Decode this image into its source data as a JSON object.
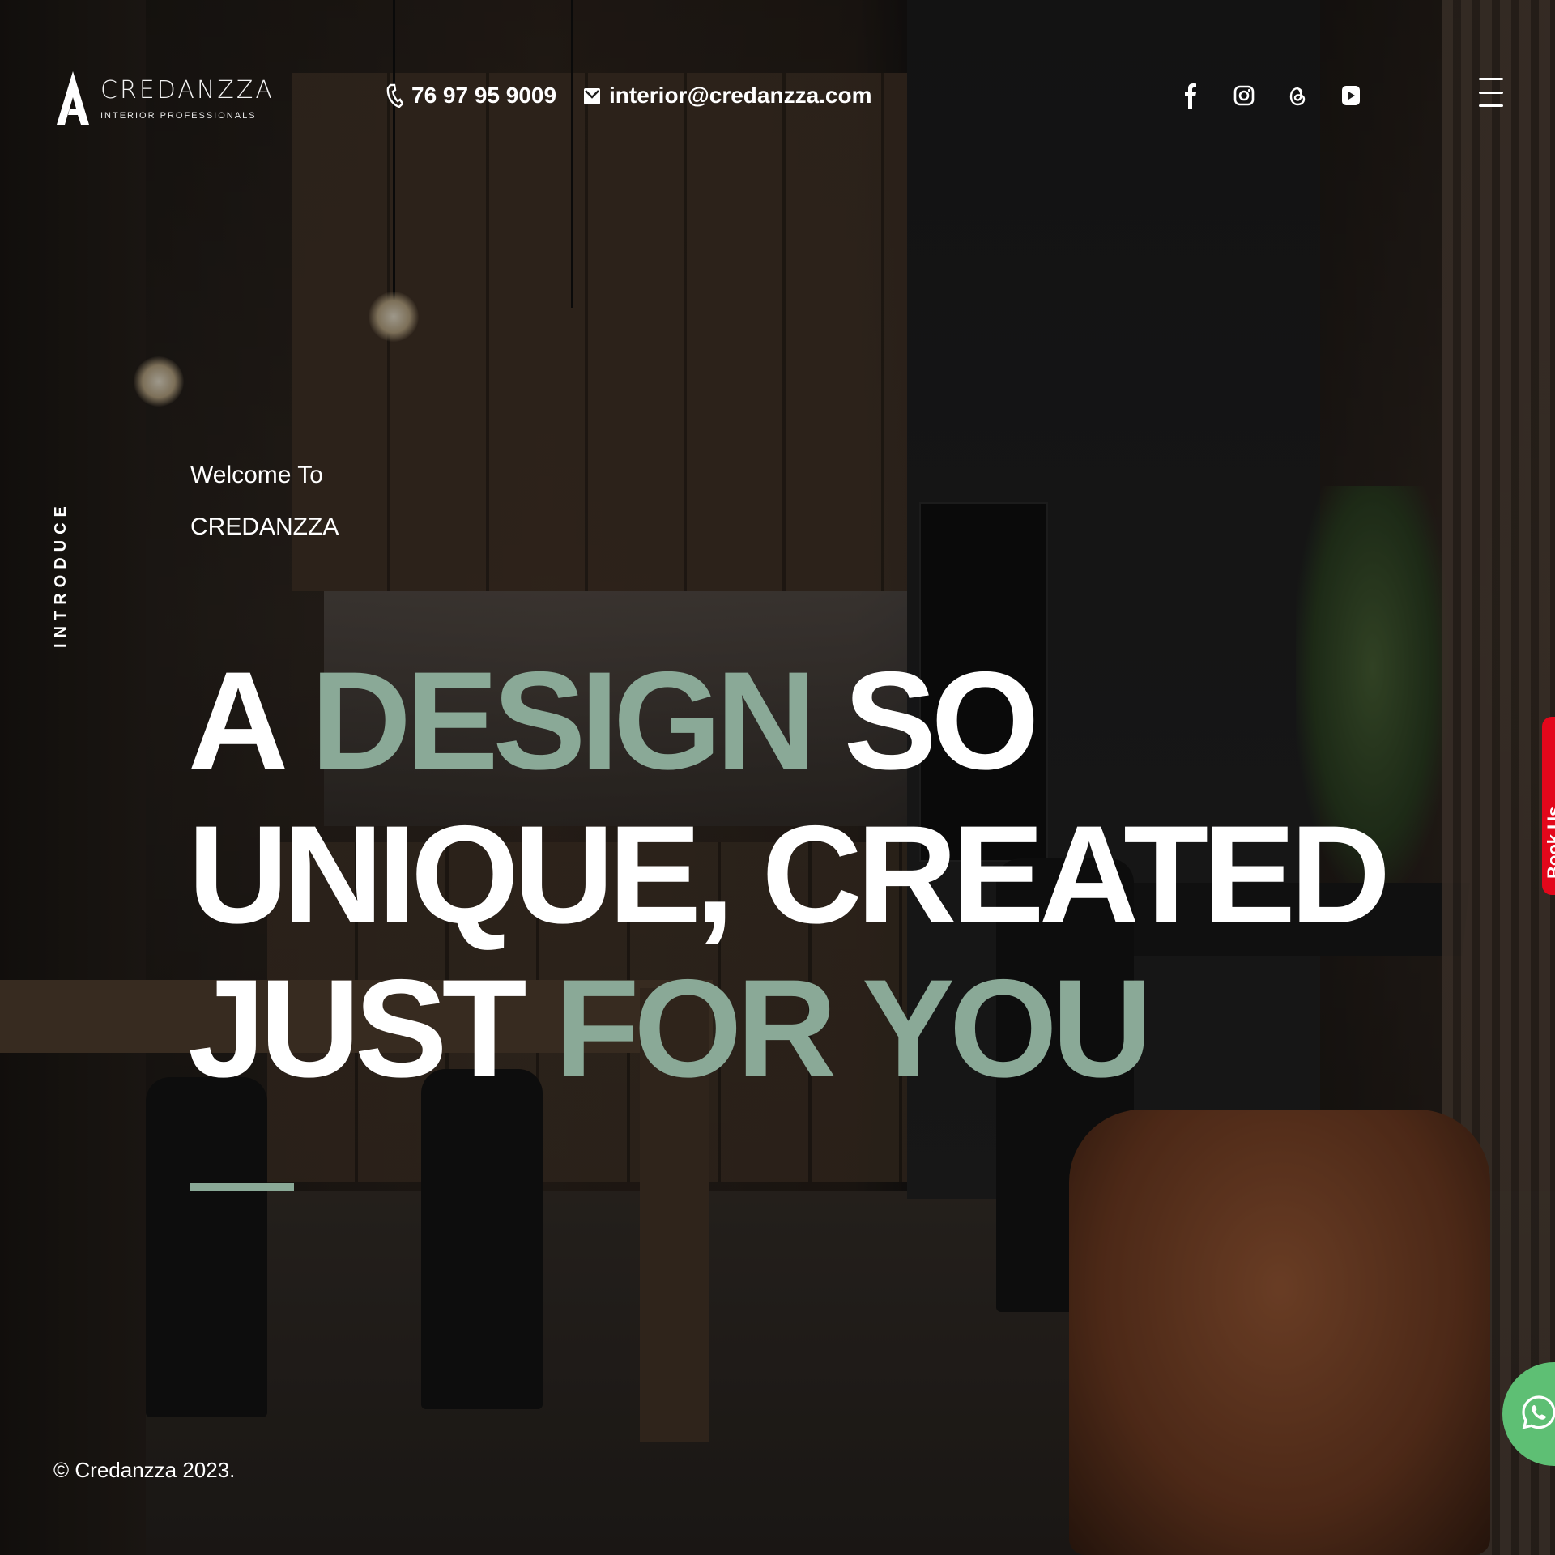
{
  "brand": {
    "name": "CREDANZZA",
    "tagline": "INTERIOR PROFESSIONALS",
    "logo_icon": "triangle-a-logo-icon"
  },
  "header": {
    "phone": "76 97 95 9009",
    "phone_icon": "phone-icon",
    "email": "interior@credanzza.com",
    "email_icon": "mail-icon",
    "socials": [
      {
        "name": "facebook",
        "icon": "facebook-icon"
      },
      {
        "name": "instagram",
        "icon": "instagram-icon"
      },
      {
        "name": "threads",
        "icon": "threads-icon"
      },
      {
        "name": "youtube",
        "icon": "youtube-icon"
      }
    ],
    "menu_icon": "hamburger-menu-icon"
  },
  "side_label": "INTRODUCE",
  "hero": {
    "welcome_line1": "Welcome To",
    "welcome_line2": "CREDANZZA",
    "headline": {
      "line1_a": "A",
      "line1_accent": "DESIGN",
      "line1_b": "SO",
      "line2": "UNIQUE, CREATED",
      "line3_a": "JUST",
      "line3_accent": "FOR YOU"
    }
  },
  "side_tab": "Book Us",
  "whatsapp_icon": "whatsapp-icon",
  "footer": {
    "copyright": "© Credanzza 2023."
  },
  "colors": {
    "accent": "#8aa997",
    "text": "#ffffff",
    "book_tab": "#e3071b",
    "whatsapp": "#5ebf74"
  }
}
